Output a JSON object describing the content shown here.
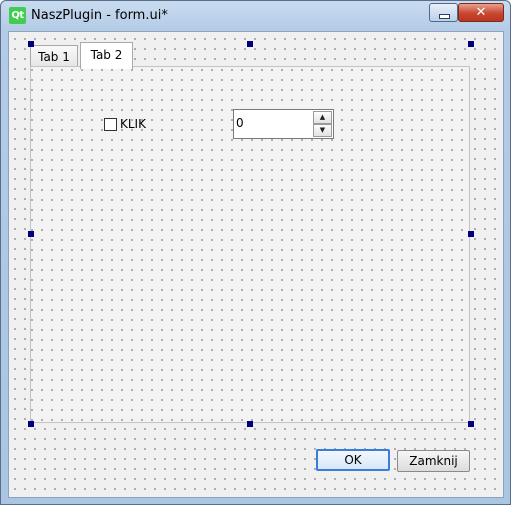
{
  "window": {
    "app_icon_text": "Qt",
    "title": "NaszPlugin - form.ui*",
    "minimize_glyph": "",
    "close_glyph": "✕"
  },
  "tabs": [
    {
      "label": "Tab 1",
      "selected": false
    },
    {
      "label": "Tab 2",
      "selected": true
    }
  ],
  "tab2": {
    "checkbox": {
      "label": "KLIK",
      "checked": false
    },
    "spinbox": {
      "value": "0",
      "up_glyph": "▲",
      "down_glyph": "▼"
    }
  },
  "buttons": {
    "ok_label": "OK",
    "close_label": "Zamknij"
  },
  "colors": {
    "selection_handle": "#00007f",
    "default_button_border": "#3b7ddd",
    "qt_logo": "#41cd52"
  }
}
